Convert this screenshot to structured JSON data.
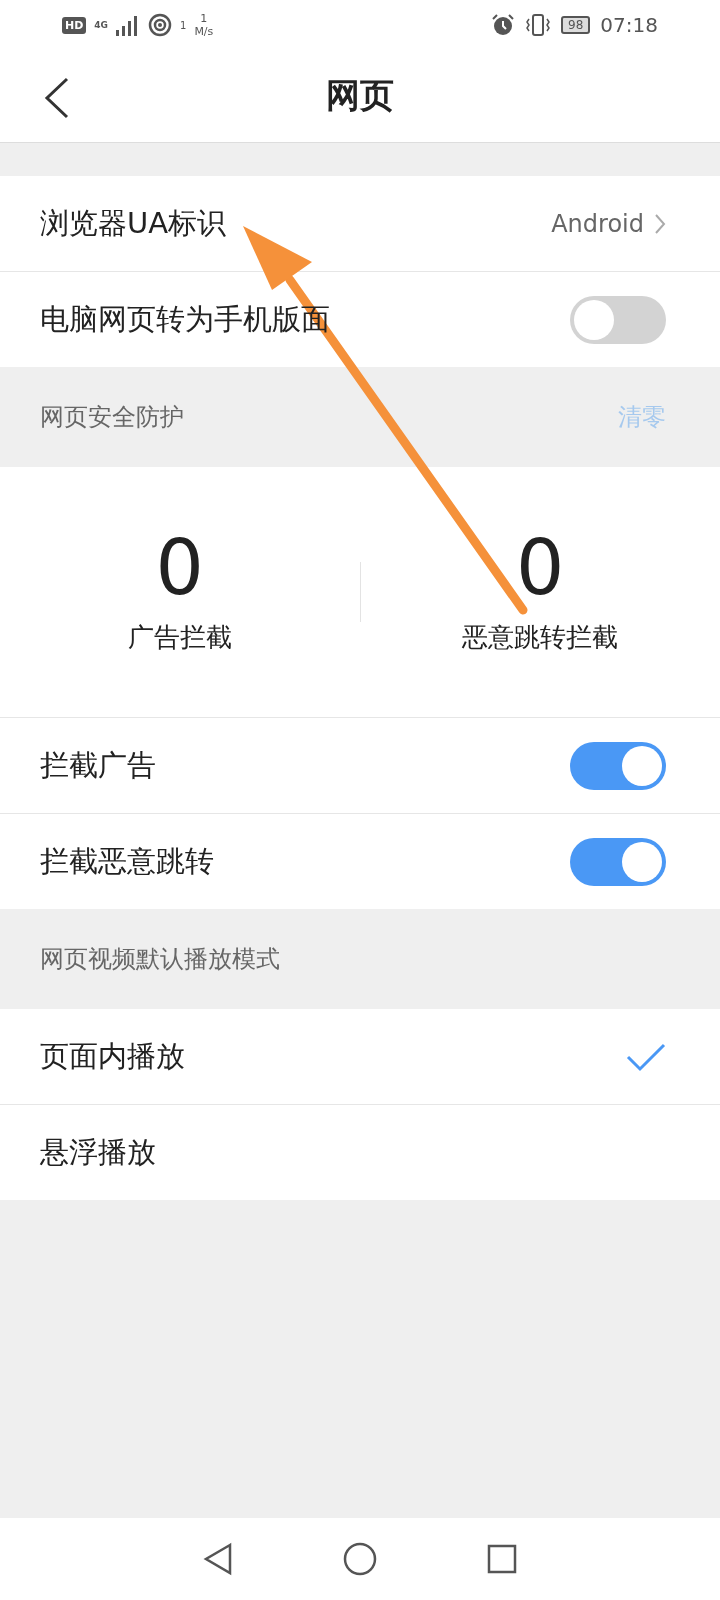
{
  "status_bar": {
    "hd": "HD",
    "network": "4G",
    "hotspot_count": "1",
    "speed_value": "1",
    "speed_unit": "M/s",
    "battery": "98",
    "time": "07:18"
  },
  "header": {
    "title": "网页"
  },
  "rows": [
    {
      "kind": "value",
      "label": "浏览器UA标识",
      "value": "Android"
    },
    {
      "kind": "toggle",
      "label": "电脑网页转为手机版面",
      "on": false
    }
  ],
  "security": {
    "title": "网页安全防护",
    "action": "清零",
    "stats": [
      {
        "count": "0",
        "label": "广告拦截"
      },
      {
        "count": "0",
        "label": "恶意跳转拦截"
      }
    ],
    "rows": [
      {
        "label": "拦截广告",
        "on": true
      },
      {
        "label": "拦截恶意跳转",
        "on": true
      }
    ]
  },
  "video": {
    "title": "网页视频默认播放模式",
    "options": [
      {
        "label": "页面内播放",
        "selected": true
      },
      {
        "label": "悬浮播放",
        "selected": false
      }
    ]
  }
}
